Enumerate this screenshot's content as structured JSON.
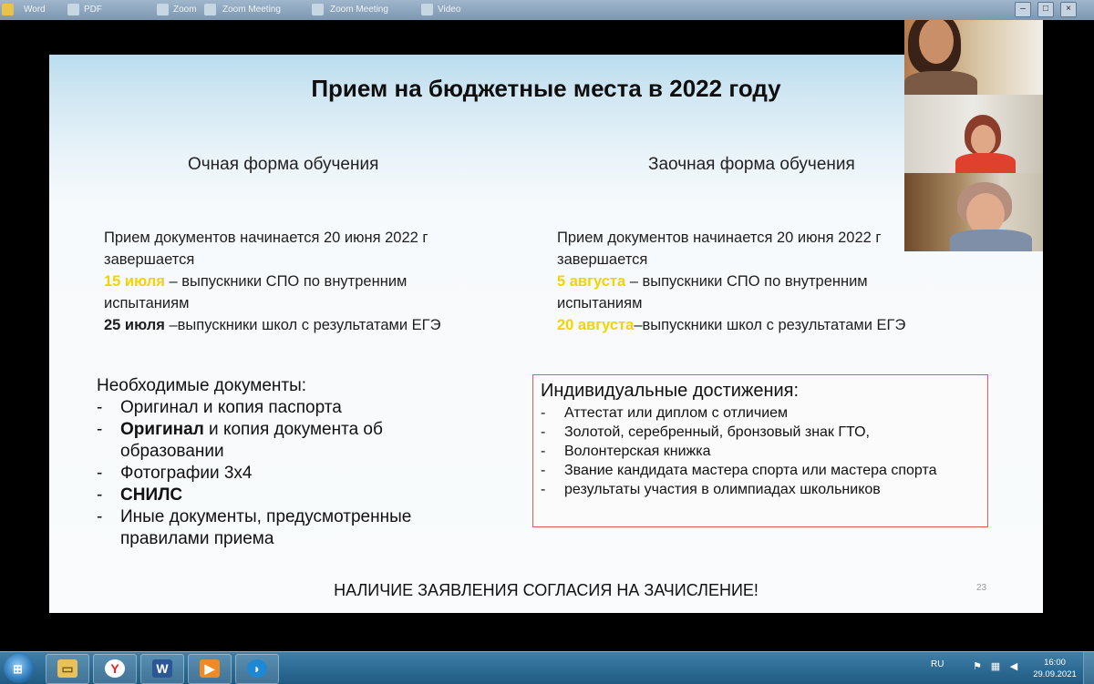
{
  "topbar": {
    "items": [
      "Word",
      "PDF",
      "Zoom",
      "Zoom Meeting",
      "Zoom Meeting",
      "Video"
    ],
    "controls": {
      "minimize": "–",
      "maximize": "□",
      "close": "×"
    }
  },
  "slide": {
    "title": "Прием на бюджетные места в 2022 году",
    "left": {
      "heading": "Очная форма обучения",
      "line1": "Прием документов начинается 20 июня 2022 г",
      "line2": "завершается",
      "date1": "15 июля",
      "rest1": " – выпускники СПО по внутренним",
      "line3b": "испытаниям",
      "date2": "25 июля",
      "rest2": " –выпускники школ с результатами ЕГЭ"
    },
    "right": {
      "heading": "Заочная форма обучения",
      "line1": "Прием документов начинается 20 июня 2022 г",
      "line2": "завершается",
      "date1": "5 августа",
      "rest1": " – выпускники СПО по внутренним",
      "line3b": "испытаниям",
      "date2": "20 августа",
      "rest2": "–выпускники школ с результатами ЕГЭ"
    },
    "documents": {
      "heading": "Необходимые документы:",
      "item1": "Оригинал и копия паспорта",
      "item2_bold": "Оригинал",
      "item2_rest": " и копия документа об образовании",
      "item3": "Фотографии 3х4",
      "item4": "СНИЛС",
      "item5": "Иные документы, предусмотренные правилами приема"
    },
    "achievements": {
      "heading": "Индивидуальные достижения:",
      "items": [
        "Аттестат или диплом с отличием",
        "Золотой, серебренный, бронзовый знак ГТО,",
        "Волонтерская книжка",
        "Звание кандидата мастера спорта  или мастера спорта",
        "результаты участия в олимпиадах школьников"
      ]
    },
    "footer": "НАЛИЧИЕ ЗАЯВЛЕНИЯ СОГЛАСИЯ НА ЗАЧИСЛЕНИЕ!",
    "page_number": "23"
  },
  "taskbar": {
    "language": "RU",
    "time": "16:00",
    "date": "29.09.2021",
    "apps": [
      "file-explorer-icon",
      "yandex-browser-icon",
      "word-icon",
      "media-player-icon",
      "app-icon"
    ]
  },
  "colors": {
    "highlight_yellow": "#f2d500",
    "achievement_border": "#e05a5a",
    "taskbar": "#2a6a95"
  }
}
